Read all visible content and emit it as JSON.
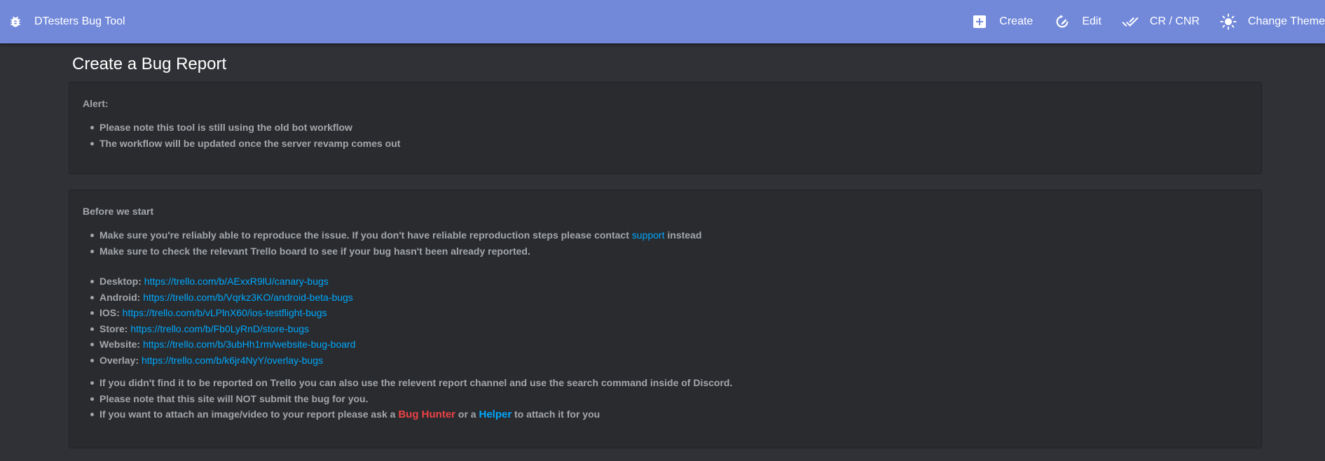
{
  "app": {
    "brand_icon": "bug-icon",
    "title": "DTesters Bug Tool"
  },
  "nav": {
    "create": {
      "label": "Create",
      "icon": "plus-box-icon"
    },
    "edit": {
      "label": "Edit",
      "icon": "refresh-pencil-icon"
    },
    "crcnr": {
      "label": "CR / CNR",
      "icon": "double-check-icon"
    },
    "theme": {
      "label": "Change Theme",
      "icon": "sun-icon"
    }
  },
  "page": {
    "title": "Create a Bug Report"
  },
  "alert": {
    "heading": "Alert:",
    "items": [
      "Please note this tool is still using the old bot workflow",
      "The workflow will be updated once the server revamp comes out"
    ]
  },
  "before_start": {
    "heading": "Before we start",
    "reproduce": {
      "before": "Make sure you're reliably able to reproduce the issue. If you don't have reliable reproduction steps please contact ",
      "link": "support",
      "after": " instead"
    },
    "check_trello": "Make sure to check the relevant Trello board to see if your bug hasn't been already reported.",
    "boards": [
      {
        "label": "Desktop:",
        "url": "https://trello.com/b/AExxR9lU/canary-bugs"
      },
      {
        "label": "Android:",
        "url": "https://trello.com/b/Vqrkz3KO/android-beta-bugs"
      },
      {
        "label": "IOS:",
        "url": "https://trello.com/b/vLPlnX60/ios-testflight-bugs"
      },
      {
        "label": "Store:",
        "url": "https://trello.com/b/Fb0LyRnD/store-bugs"
      },
      {
        "label": "Website:",
        "url": "https://trello.com/b/3ubHh1rm/website-bug-board"
      },
      {
        "label": "Overlay:",
        "url": "https://trello.com/b/k6jr4NyY/overlay-bugs"
      }
    ],
    "not_found": "If you didn't find it to be reported on Trello you can also use the relevent report channel and use the search command inside of Discord.",
    "not_submit": "Please note that this site will NOT submit the bug for you.",
    "attach": {
      "before": "If you want to attach an image/video to your report please ask a ",
      "role1": "Bug Hunter",
      "middle": " or a ",
      "role2": "Helper",
      "after": " to attach it for you"
    }
  },
  "colors": {
    "topbar": "#7289da",
    "background": "#2f3136",
    "card": "#292b2f",
    "text": "#a3a6aa",
    "link": "#00a8fc",
    "bug_hunter": "#ed4245",
    "helper": "#00a8fc"
  }
}
